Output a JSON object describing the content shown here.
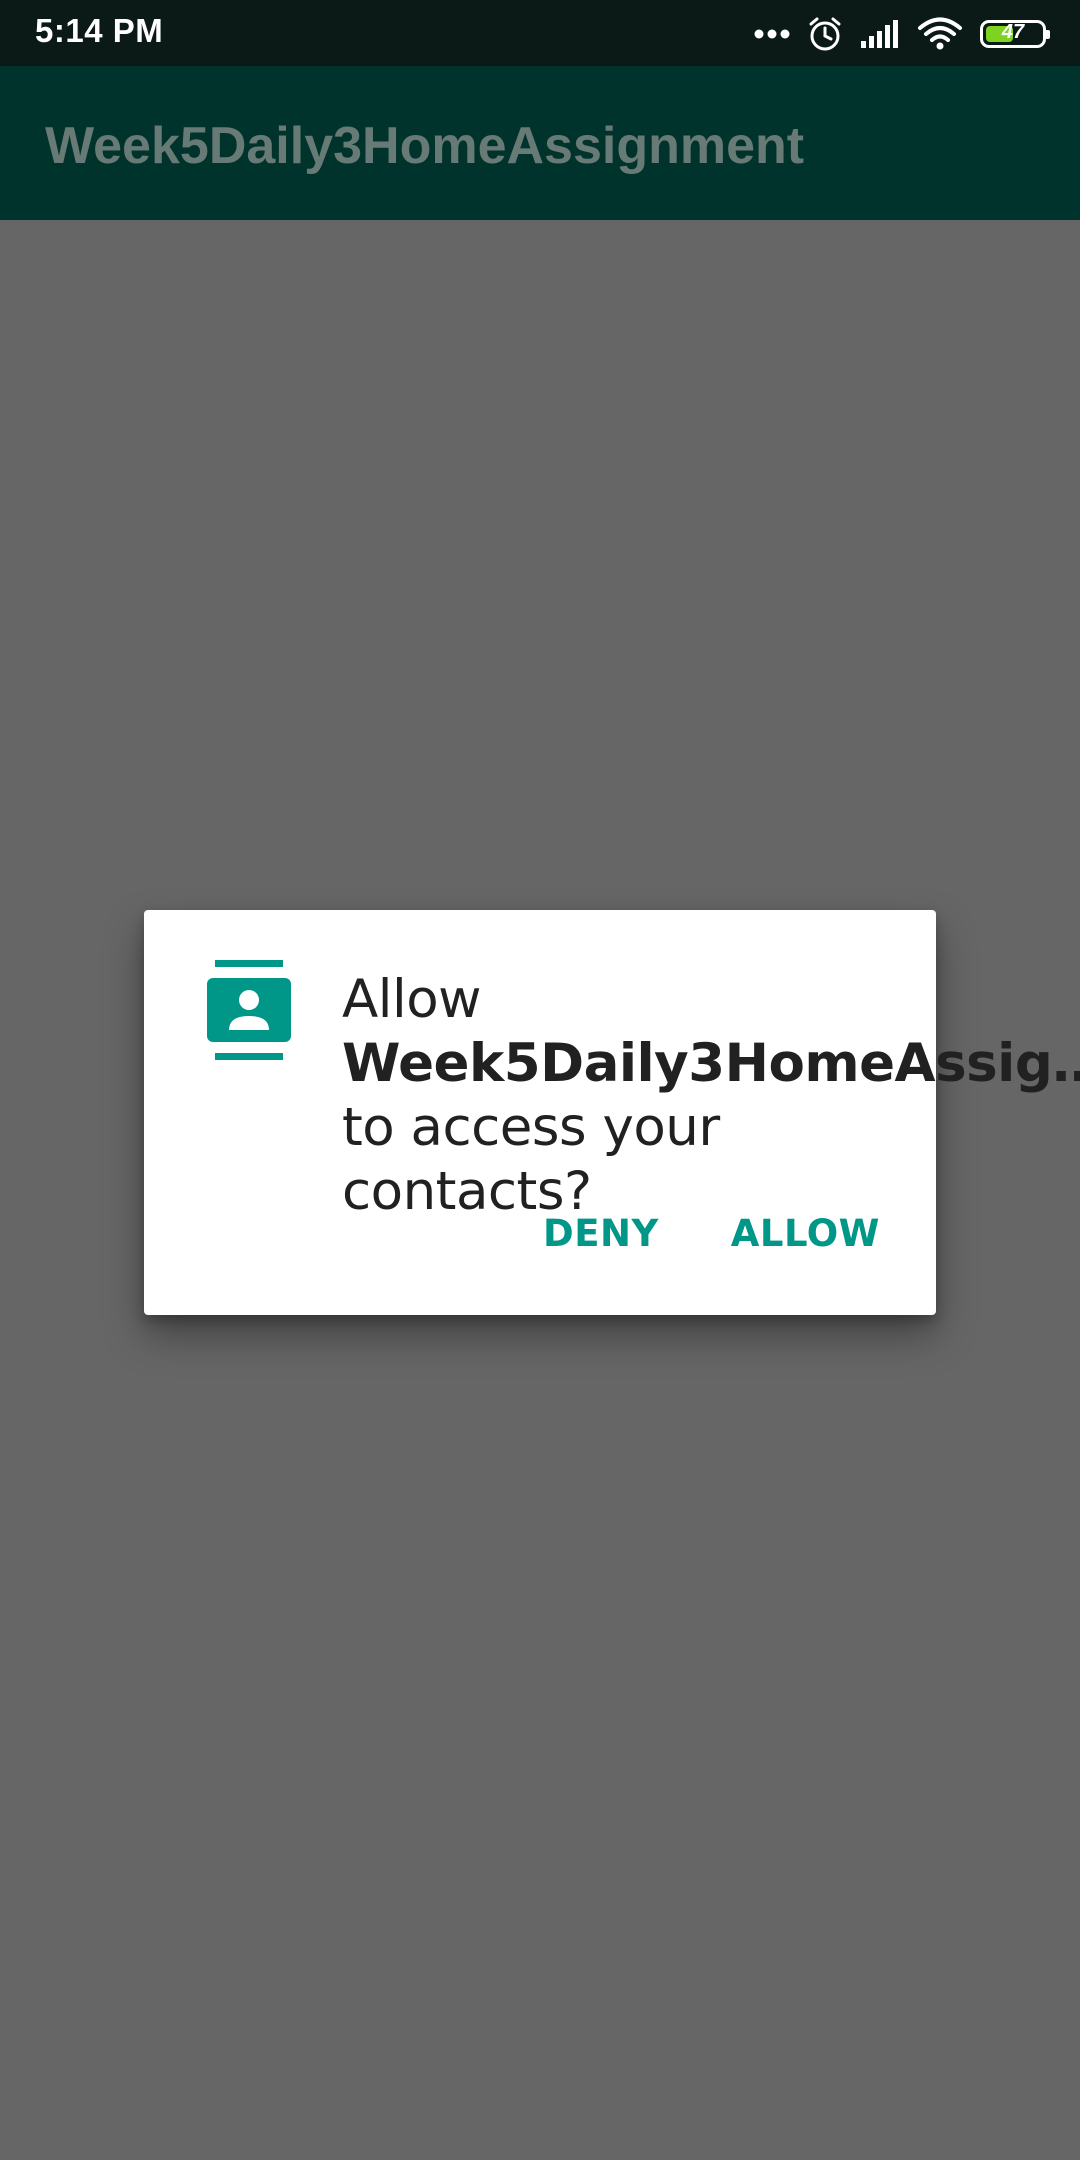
{
  "status_bar": {
    "time": "5:14 PM",
    "battery_level": "47",
    "icons": [
      "more-dots-icon",
      "alarm-icon",
      "signal-icon",
      "wifi-icon",
      "battery-icon"
    ]
  },
  "app_bar": {
    "title": "Week5Daily3HomeAssignment"
  },
  "permission_dialog": {
    "icon": "contacts-icon",
    "message_prefix": "Allow ",
    "app_name": "Week5Daily3HomeAssig…",
    "message_suffix": " to access your contacts?",
    "deny_label": "DENY",
    "allow_label": "ALLOW"
  },
  "colors": {
    "accent": "#009688",
    "app_bar": "#00332c",
    "scrim": "#666666",
    "status_bar": "#0b1a17"
  }
}
